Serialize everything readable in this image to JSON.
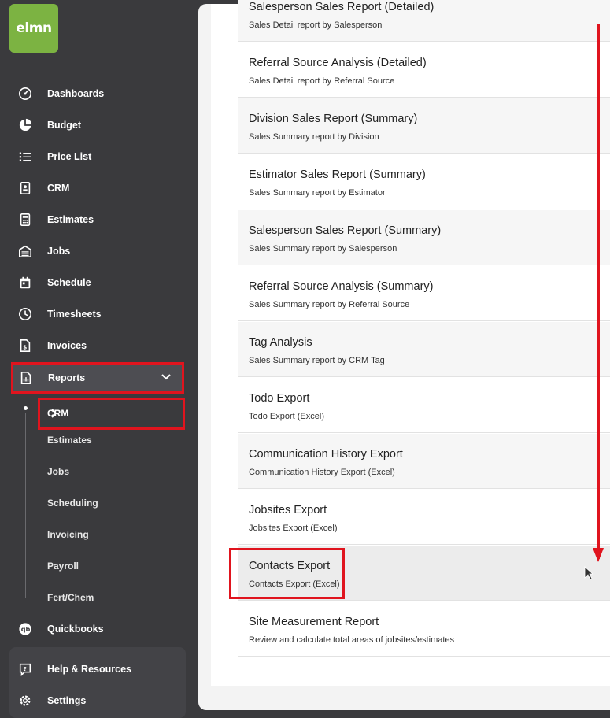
{
  "app": {
    "logo_text": "elmn",
    "brand_color": "#7cb342",
    "highlight_color": "#e0141e"
  },
  "sidebar": {
    "items": [
      {
        "label": "Dashboards",
        "icon": "dashboard-gauge-icon"
      },
      {
        "label": "Budget",
        "icon": "pie-chart-icon"
      },
      {
        "label": "Price List",
        "icon": "list-icon"
      },
      {
        "label": "CRM",
        "icon": "contact-card-icon"
      },
      {
        "label": "Estimates",
        "icon": "calculator-icon"
      },
      {
        "label": "Jobs",
        "icon": "garage-icon"
      },
      {
        "label": "Schedule",
        "icon": "calendar-icon"
      },
      {
        "label": "Timesheets",
        "icon": "clock-icon"
      },
      {
        "label": "Invoices",
        "icon": "invoice-icon"
      }
    ],
    "reports": {
      "label": "Reports",
      "icon": "report-document-icon",
      "expanded": true
    },
    "reports_sub": [
      "CRM",
      "Estimates",
      "Jobs",
      "Scheduling",
      "Invoicing",
      "Payroll",
      "Fert/Chem"
    ],
    "quickbooks": {
      "label": "Quickbooks",
      "icon": "quickbooks-icon"
    },
    "help": {
      "label": "Help & Resources",
      "icon": "help-chat-icon"
    },
    "settings": {
      "label": "Settings",
      "icon": "gear-icon"
    }
  },
  "reports": [
    {
      "title": "Salesperson Sales Report (Detailed)",
      "subtitle": "Sales Detail report by Salesperson"
    },
    {
      "title": "Referral Source Analysis (Detailed)",
      "subtitle": "Sales Detail report by Referral Source"
    },
    {
      "title": "Division Sales Report (Summary)",
      "subtitle": "Sales Summary report by Division"
    },
    {
      "title": "Estimator Sales Report (Summary)",
      "subtitle": "Sales Summary report by Estimator"
    },
    {
      "title": "Salesperson Sales Report (Summary)",
      "subtitle": "Sales Summary report by Salesperson"
    },
    {
      "title": "Referral Source Analysis (Summary)",
      "subtitle": "Sales Summary report by Referral Source"
    },
    {
      "title": "Tag Analysis",
      "subtitle": "Sales Summary report by CRM Tag"
    },
    {
      "title": "Todo Export",
      "subtitle": "Todo Export (Excel)"
    },
    {
      "title": "Communication History Export",
      "subtitle": "Communication History Export (Excel)"
    },
    {
      "title": "Jobsites Export",
      "subtitle": "Jobsites Export (Excel)"
    },
    {
      "title": "Contacts Export",
      "subtitle": "Contacts Export (Excel)"
    },
    {
      "title": "Site Measurement Report",
      "subtitle": "Review and calculate total areas of jobsites/estimates"
    }
  ]
}
